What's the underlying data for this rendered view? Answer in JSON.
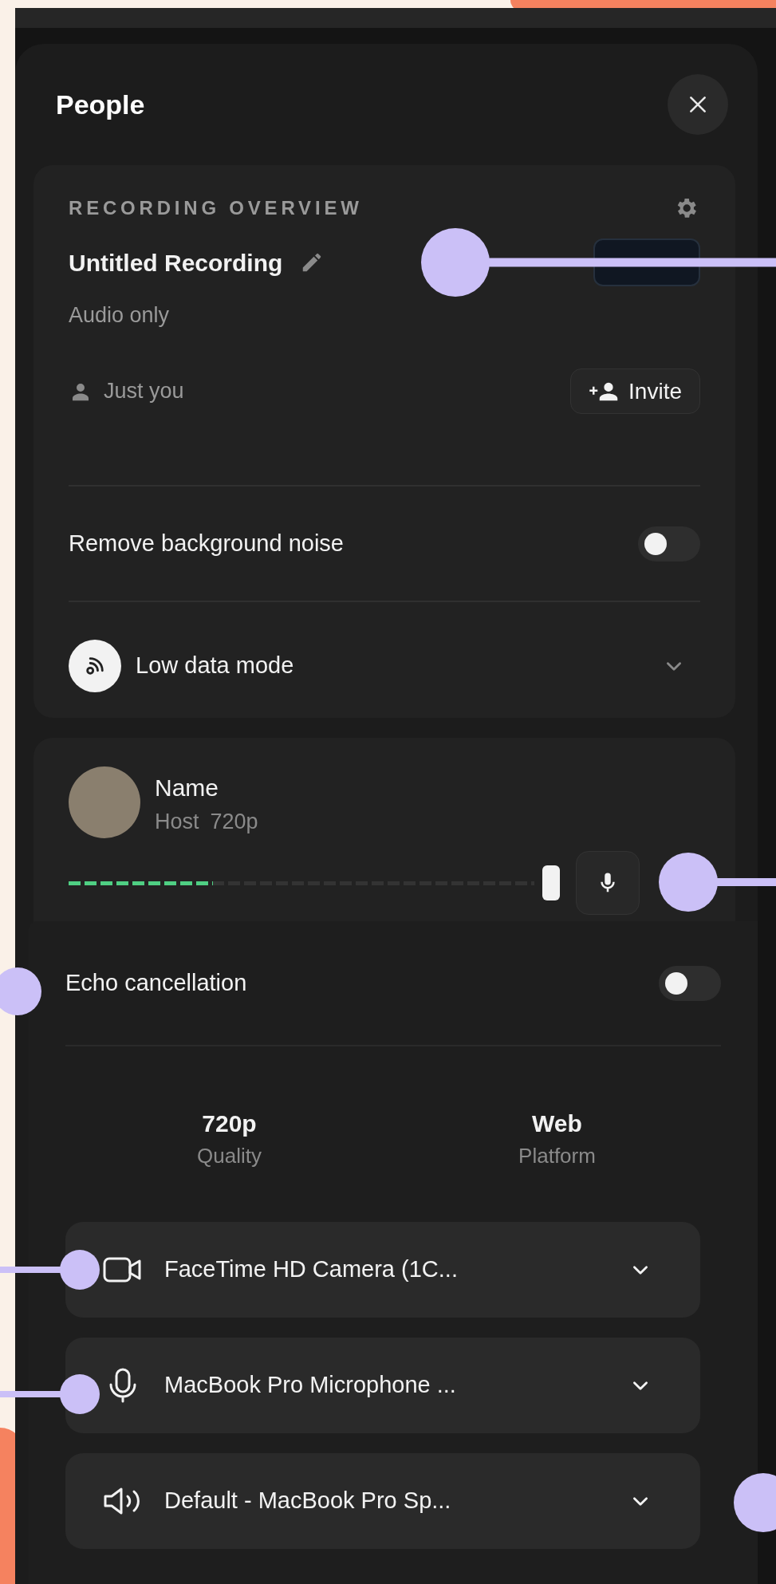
{
  "panel": {
    "title": "People"
  },
  "overview": {
    "heading": "RECORDING OVERVIEW",
    "recording_name": "Untitled Recording",
    "subtitle": "Audio only",
    "participants": "Just you",
    "invite_button": "Invite",
    "settings": [
      {
        "kind": "toggle",
        "label": "Remove background noise",
        "on": false
      },
      {
        "kind": "select",
        "label": "Low data mode",
        "expanded": false
      }
    ]
  },
  "participant": {
    "name": "Name",
    "role": "Host",
    "quality": "720p",
    "meter": {
      "level": 0.31
    },
    "volume": {
      "level": 1
    }
  },
  "echo_cancellation": {
    "label": "Echo cancellation",
    "on": false
  },
  "stats": [
    {
      "value": "720p",
      "label": "Quality"
    },
    {
      "value": "Web",
      "label": "Platform"
    }
  ],
  "devices": [
    {
      "kind": "camera",
      "label": "FaceTime HD Camera (1C..."
    },
    {
      "kind": "microphone",
      "label": "MacBook Pro Microphone ..."
    },
    {
      "kind": "speaker",
      "label": "Default - MacBook Pro Sp..."
    }
  ]
}
